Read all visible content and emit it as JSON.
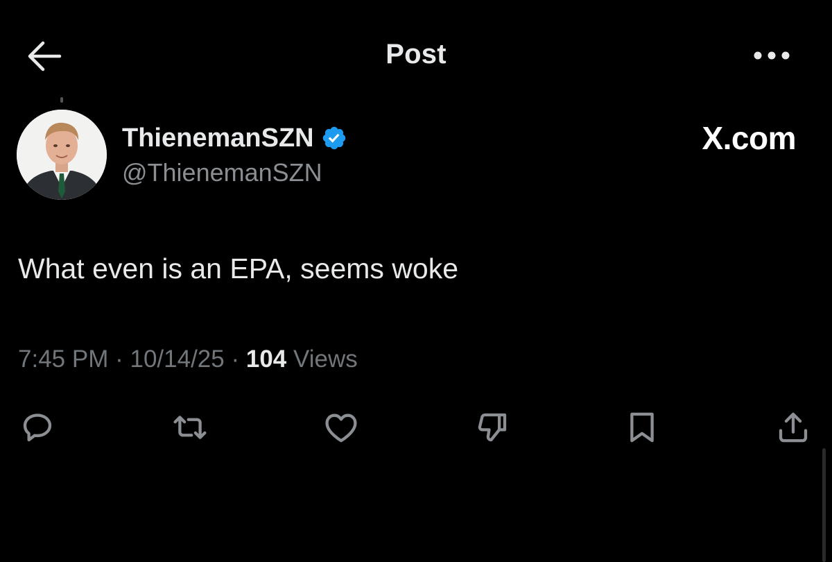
{
  "header": {
    "title": "Post",
    "back_icon": "arrow-left-icon",
    "more_icon": "more-horizontal-icon"
  },
  "author": {
    "display_name": "ThienemanSZN",
    "handle": "@ThienemanSZN",
    "verified": true,
    "verified_color": "#1d9bf0"
  },
  "brand": {
    "label": "X.com"
  },
  "post": {
    "text": "What even is an EPA, seems woke",
    "time": "7:45 PM",
    "date": "10/14/25",
    "views_count": "104",
    "views_label": "Views"
  },
  "actions": [
    {
      "name": "reply",
      "icon": "reply-icon"
    },
    {
      "name": "repost",
      "icon": "repost-icon"
    },
    {
      "name": "like",
      "icon": "heart-icon"
    },
    {
      "name": "dislike",
      "icon": "thumbs-down-icon"
    },
    {
      "name": "bookmark",
      "icon": "bookmark-icon"
    },
    {
      "name": "share",
      "icon": "share-icon"
    }
  ],
  "colors": {
    "background": "#000000",
    "primary_text": "#e7e9ea",
    "secondary_text": "#71767b",
    "icon": "#8b8f93"
  }
}
